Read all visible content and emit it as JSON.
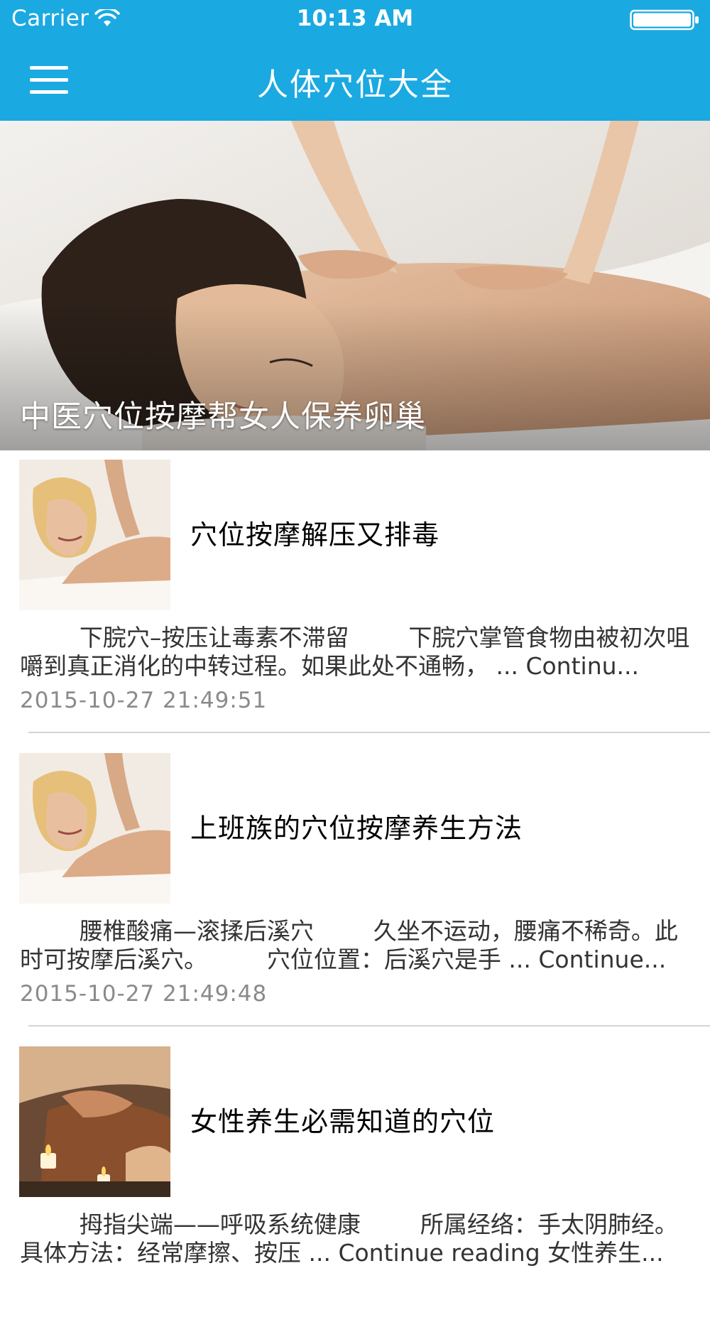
{
  "status_bar": {
    "carrier": "Carrier",
    "time": "10:13 AM"
  },
  "nav": {
    "title": "人体穴位大全",
    "menu_icon": "hamburger-menu-icon"
  },
  "hero": {
    "caption": "中医穴位按摩帮女人保养卵巢"
  },
  "articles": [
    {
      "title": "穴位按摩解压又排毒",
      "excerpt": "        下脘穴–按压让毒素不滞留        下脘穴掌管食物由被初次咀嚼到真正消化的中转过程。如果此处不通畅， ... Continu...",
      "date": "2015-10-27 21:49:51"
    },
    {
      "title": "上班族的穴位按摩养生方法",
      "excerpt": "        腰椎酸痛—滚揉后溪穴        久坐不运动，腰痛不稀奇。此时可按摩后溪穴。        穴位位置：后溪穴是手 ... Continue...",
      "date": "2015-10-27 21:49:48"
    },
    {
      "title": "女性养生必需知道的穴位",
      "excerpt": "        拇指尖端——呼吸系统健康        所属经络：手太阴肺经。具体方法：经常摩擦、按压 ... Continue reading 女性养生...",
      "date": ""
    }
  ],
  "colors": {
    "nav_bg": "#1ba9e1",
    "divider": "#d4d4d4",
    "date_text": "#8a8a8a"
  }
}
